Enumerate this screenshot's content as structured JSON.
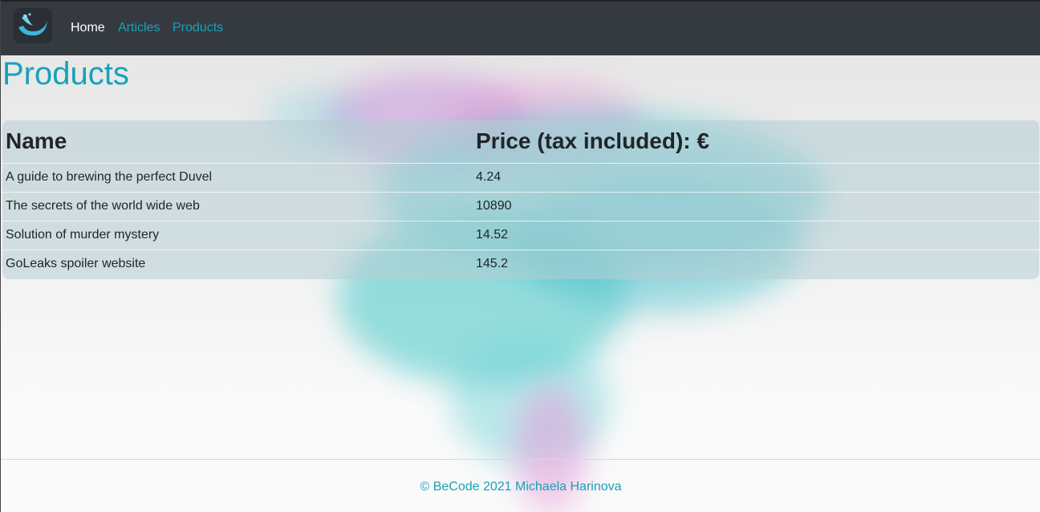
{
  "nav": {
    "logo_alt": "BeCode logo",
    "links": [
      {
        "label": "Home",
        "active": true
      },
      {
        "label": "Articles",
        "active": false
      },
      {
        "label": "Products",
        "active": false
      }
    ]
  },
  "page": {
    "title": "Products"
  },
  "table": {
    "headers": [
      "Name",
      "Price (tax included): €"
    ],
    "rows": [
      {
        "name": "A guide to brewing the perfect Duvel",
        "price": "4.24"
      },
      {
        "name": "The secrets of the world wide web",
        "price": "10890"
      },
      {
        "name": "Solution of murder mystery",
        "price": "14.52"
      },
      {
        "name": "GoLeaks spoiler website",
        "price": "145.2"
      }
    ]
  },
  "footer": {
    "text": "© BeCode 2021 Michaela Harinova"
  },
  "colors": {
    "navbar": "#343a40",
    "accent": "#17a2b8",
    "nav_active": "#ffffff"
  }
}
